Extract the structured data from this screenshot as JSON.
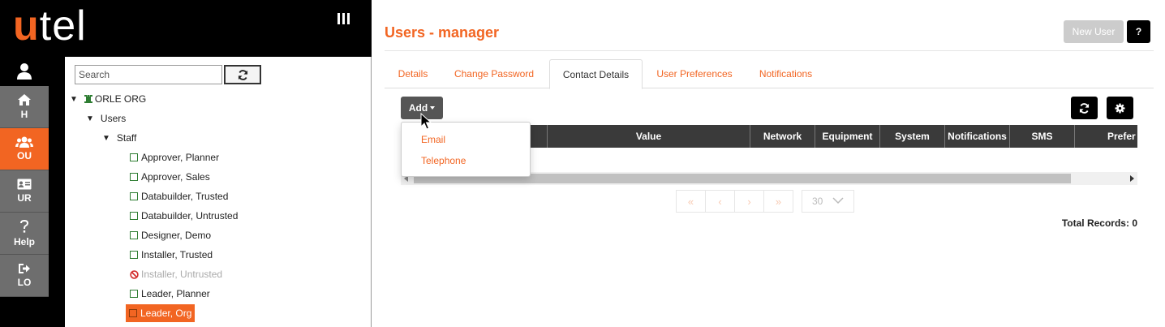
{
  "brand": {
    "logo_u": "u",
    "logo_rest": "tel",
    "accent": "#f26522"
  },
  "nav": {
    "user_icon": "user-icon",
    "items": [
      {
        "label": "H",
        "icon": "home-icon",
        "active": false
      },
      {
        "label": "OU",
        "icon": "users-icon",
        "active": true
      },
      {
        "label": "UR",
        "icon": "id-card-icon",
        "active": false
      },
      {
        "label": "Help",
        "icon": "question-icon",
        "active": false
      },
      {
        "label": "LO",
        "icon": "logout-icon",
        "active": false
      }
    ]
  },
  "tree": {
    "search_placeholder": "Search",
    "nodes": [
      {
        "label": "ORLE ORG",
        "level": 0,
        "expanded": true,
        "icon": "org-icon"
      },
      {
        "label": "Users",
        "level": 1,
        "expanded": true
      },
      {
        "label": "Staff",
        "level": 2,
        "expanded": true
      },
      {
        "label": "Approver, Planner",
        "level": 3,
        "state": "normal"
      },
      {
        "label": "Approver, Sales",
        "level": 3,
        "state": "normal"
      },
      {
        "label": "Databuilder, Trusted",
        "level": 3,
        "state": "normal"
      },
      {
        "label": "Databuilder, Untrusted",
        "level": 3,
        "state": "normal"
      },
      {
        "label": "Designer, Demo",
        "level": 3,
        "state": "normal"
      },
      {
        "label": "Installer, Trusted",
        "level": 3,
        "state": "normal"
      },
      {
        "label": "Installer, Untrusted",
        "level": 3,
        "state": "disabled"
      },
      {
        "label": "Leader, Planner",
        "level": 3,
        "state": "normal"
      },
      {
        "label": "Leader, Org",
        "level": 3,
        "state": "selected"
      }
    ]
  },
  "main": {
    "title": "Users - manager",
    "new_user_label": "New User",
    "help_label": "?",
    "tabs": [
      {
        "label": "Details",
        "active": false
      },
      {
        "label": "Change Password",
        "active": false
      },
      {
        "label": "Contact Details",
        "active": true
      },
      {
        "label": "User Preferences",
        "active": false
      },
      {
        "label": "Notifications",
        "active": false
      }
    ],
    "add_label": "Add",
    "add_menu": [
      "Email",
      "Telephone"
    ],
    "columns": [
      "",
      "Value",
      "Network",
      "Equipment",
      "System",
      "Notifications",
      "SMS",
      "Prefer"
    ],
    "pager": {
      "first": "«",
      "prev": "‹",
      "next": "›",
      "last": "»",
      "page_size": "30"
    },
    "total_records": "Total Records: 0"
  }
}
